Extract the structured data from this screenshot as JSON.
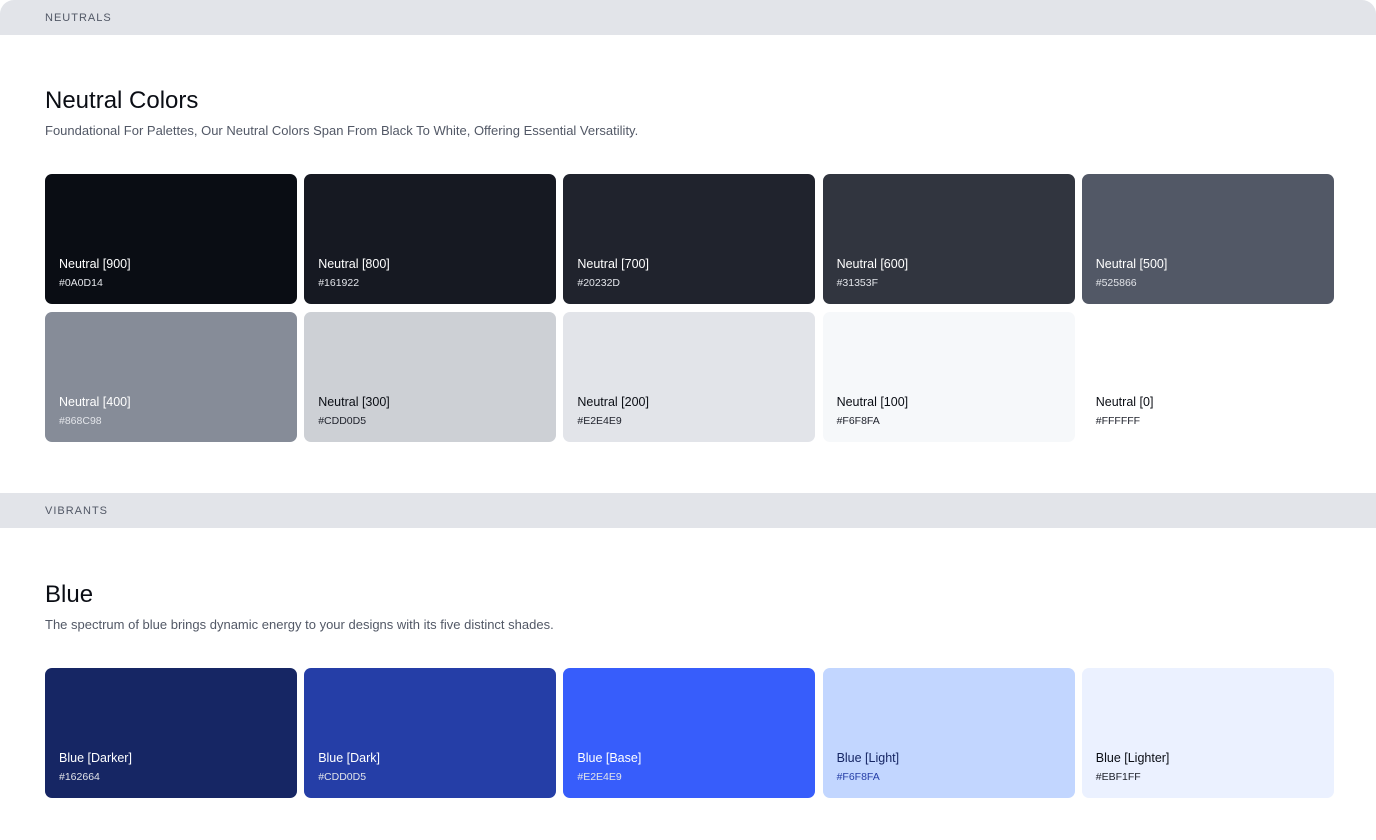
{
  "sections": {
    "neutrals_label": "NEUTRALS",
    "vibrants_label": "VIBRANTS"
  },
  "neutral": {
    "title": "Neutral Colors",
    "description": "Foundational For Palettes, Our Neutral Colors Span From Black To White, Offering Essential Versatility.",
    "swatches": [
      {
        "name": "Neutral [900]",
        "hex": "#0A0D14",
        "color": "#0a0d14",
        "text": "light"
      },
      {
        "name": "Neutral [800]",
        "hex": "#161922",
        "color": "#161922",
        "text": "light"
      },
      {
        "name": "Neutral [700]",
        "hex": "#20232D",
        "color": "#20232d",
        "text": "light"
      },
      {
        "name": "Neutral [600]",
        "hex": "#31353F",
        "color": "#31353f",
        "text": "light"
      },
      {
        "name": "Neutral [500]",
        "hex": "#525866",
        "color": "#525866",
        "text": "light"
      },
      {
        "name": "Neutral [400]",
        "hex": "#868C98",
        "color": "#868c98",
        "text": "light"
      },
      {
        "name": "Neutral [300]",
        "hex": "#CDD0D5",
        "color": "#cdd0d5",
        "text": "dark"
      },
      {
        "name": "Neutral [200]",
        "hex": "#E2E4E9",
        "color": "#e2e4e9",
        "text": "dark"
      },
      {
        "name": "Neutral [100]",
        "hex": "#F6F8FA",
        "color": "#f6f8fa",
        "text": "dark"
      },
      {
        "name": "Neutral [0]",
        "hex": "#FFFFFF",
        "color": "#ffffff",
        "text": "dark"
      }
    ]
  },
  "blue": {
    "title": "Blue",
    "description": "The spectrum of blue brings dynamic energy to your designs with its five distinct shades.",
    "swatches": [
      {
        "name": "Blue [Darker]",
        "hex": "#162664",
        "color": "#162664",
        "text": "light"
      },
      {
        "name": "Blue [Dark]",
        "hex": "#CDD0D5",
        "color": "#253ea7",
        "text": "light"
      },
      {
        "name": "Blue [Base]",
        "hex": "#E2E4E9",
        "color": "#375dfb",
        "text": "light"
      },
      {
        "name": "Blue [Light]",
        "hex": "#F6F8FA",
        "color": "#c2d6ff",
        "text": "blue"
      },
      {
        "name": "Blue [Lighter]",
        "hex": "#EBF1FF",
        "color": "#ebf1ff",
        "text": "dark"
      }
    ]
  }
}
